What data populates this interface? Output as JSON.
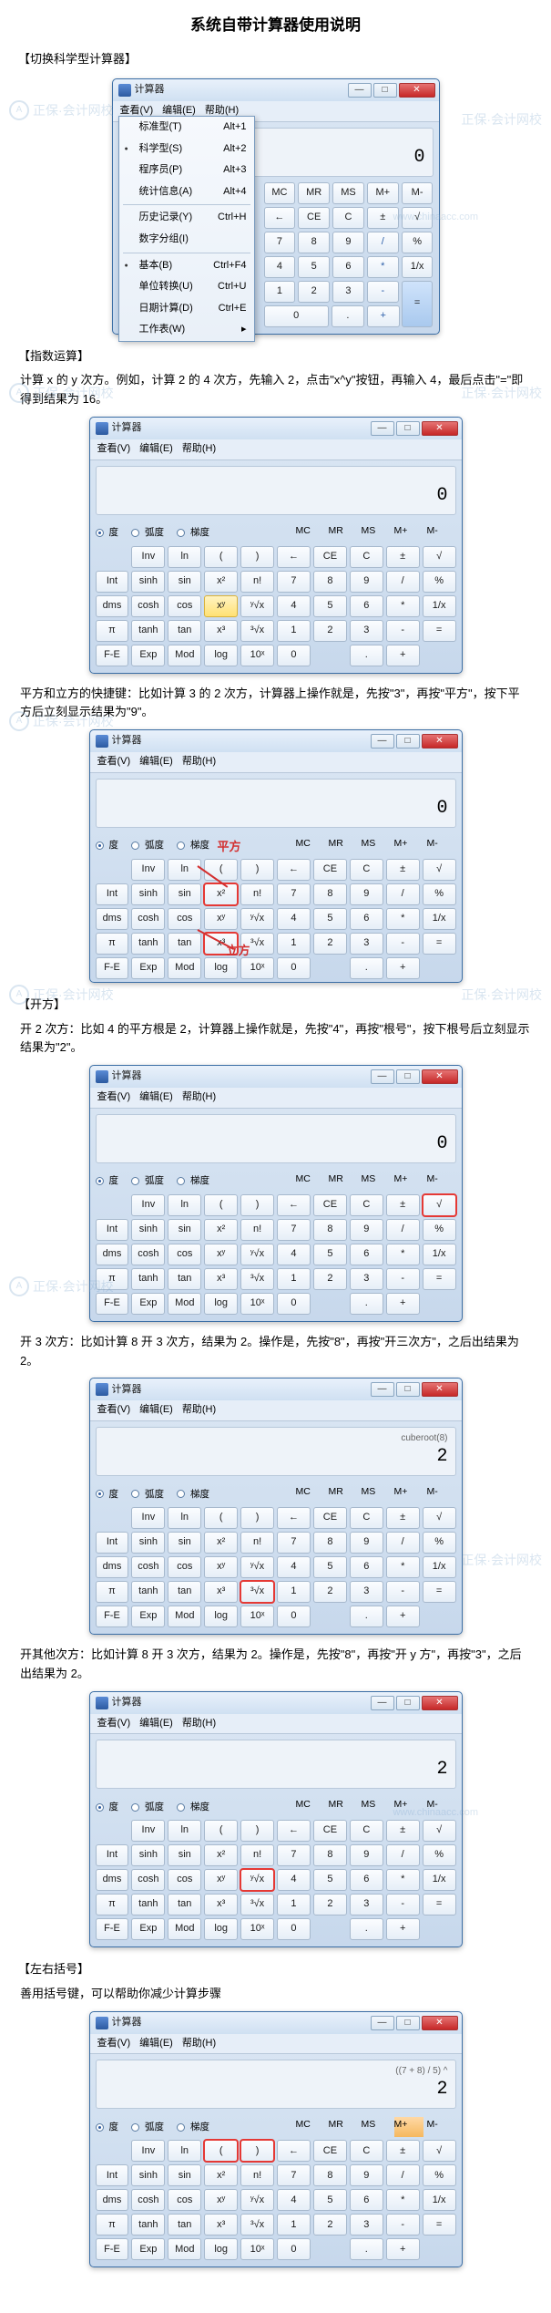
{
  "title": "系统自带计算器使用说明",
  "watermark_text": "正保·会计网校",
  "watermark_url": "www.chinaacc.com",
  "sections": {
    "s1": {
      "heading": "【切换科学型计算器】"
    },
    "s2": {
      "heading": "【指数运算】",
      "p1": "计算 x 的 y 次方。例如，计算 2 的 4 次方，先输入 2，点击\"x^y\"按钮，再输入 4，最后点击\"=\"即得到结果为 16。",
      "p2": "平方和立方的快捷键：比如计算 3 的 2 次方，计算器上操作就是，先按\"3\"，再按\"平方\"，按下平方后立刻显示结果为\"9\"。"
    },
    "s3": {
      "heading": "【开方】",
      "p1": "开 2 次方：比如 4 的平方根是 2，计算器上操作就是，先按\"4\"，再按\"根号\"，按下根号后立刻显示结果为\"2\"。",
      "p2": "开 3 次方：比如计算 8 开 3 次方，结果为 2。操作是，先按\"8\"，再按\"开三次方\"，之后出结果为 2。",
      "p3": "开其他次方：比如计算 8 开 3 次方，结果为 2。操作是，先按\"8\"，再按\"开 y 方\"，再按\"3\"，之后出结果为 2。"
    },
    "s4": {
      "heading": "【左右括号】",
      "p1": "善用括号键，可以帮助你减少计算步骤"
    }
  },
  "calc": {
    "title": "计算器",
    "menu": {
      "view": "查看(V)",
      "edit": "编辑(E)",
      "help": "帮助(H)"
    },
    "dropdown": [
      {
        "label": "标准型(T)",
        "hint": "Alt+1"
      },
      {
        "label": "科学型(S)",
        "hint": "Alt+2",
        "on": true
      },
      {
        "label": "程序员(P)",
        "hint": "Alt+3"
      },
      {
        "label": "统计信息(A)",
        "hint": "Alt+4"
      },
      {
        "sep": true
      },
      {
        "label": "历史记录(Y)",
        "hint": "Ctrl+H"
      },
      {
        "label": "数字分组(I)",
        "hint": ""
      },
      {
        "sep": true
      },
      {
        "label": "基本(B)",
        "hint": "Ctrl+F4",
        "on": true
      },
      {
        "label": "单位转换(U)",
        "hint": "Ctrl+U"
      },
      {
        "label": "日期计算(D)",
        "hint": "Ctrl+E"
      },
      {
        "label": "工作表(W)",
        "hint": "▸"
      }
    ],
    "modes": {
      "deg": "度",
      "rad": "弧度",
      "grad": "梯度"
    },
    "mem": [
      "MC",
      "MR",
      "MS",
      "M+",
      "M-"
    ],
    "row_funcA": [
      "",
      "Inv",
      "ln",
      "(",
      ")",
      "←",
      "CE",
      "C",
      "±",
      "√"
    ],
    "row_funcB": [
      "Int",
      "sinh",
      "sin",
      "x²",
      "n!",
      "7",
      "8",
      "9",
      "/",
      "%"
    ],
    "row_funcC": [
      "dms",
      "cosh",
      "cos",
      "xʸ",
      "ʸ√x",
      "4",
      "5",
      "6",
      "*",
      "1/x"
    ],
    "row_funcD": [
      "π",
      "tanh",
      "tan",
      "x³",
      "³√x",
      "1",
      "2",
      "3",
      "-",
      "="
    ],
    "row_funcE": [
      "F-E",
      "Exp",
      "Mod",
      "log",
      "10ˣ",
      "0",
      "",
      ".",
      "+",
      ""
    ]
  },
  "displays": {
    "d1": "0",
    "d2": "0",
    "d3": "0",
    "d4": "0",
    "d5_expr": "cuberoot(8)",
    "d5": "2",
    "d6": "2",
    "d7_expr": "((7 + 8) / 5) ^",
    "d7": "2"
  },
  "annotations": {
    "square": "平方",
    "cube": "立方"
  }
}
